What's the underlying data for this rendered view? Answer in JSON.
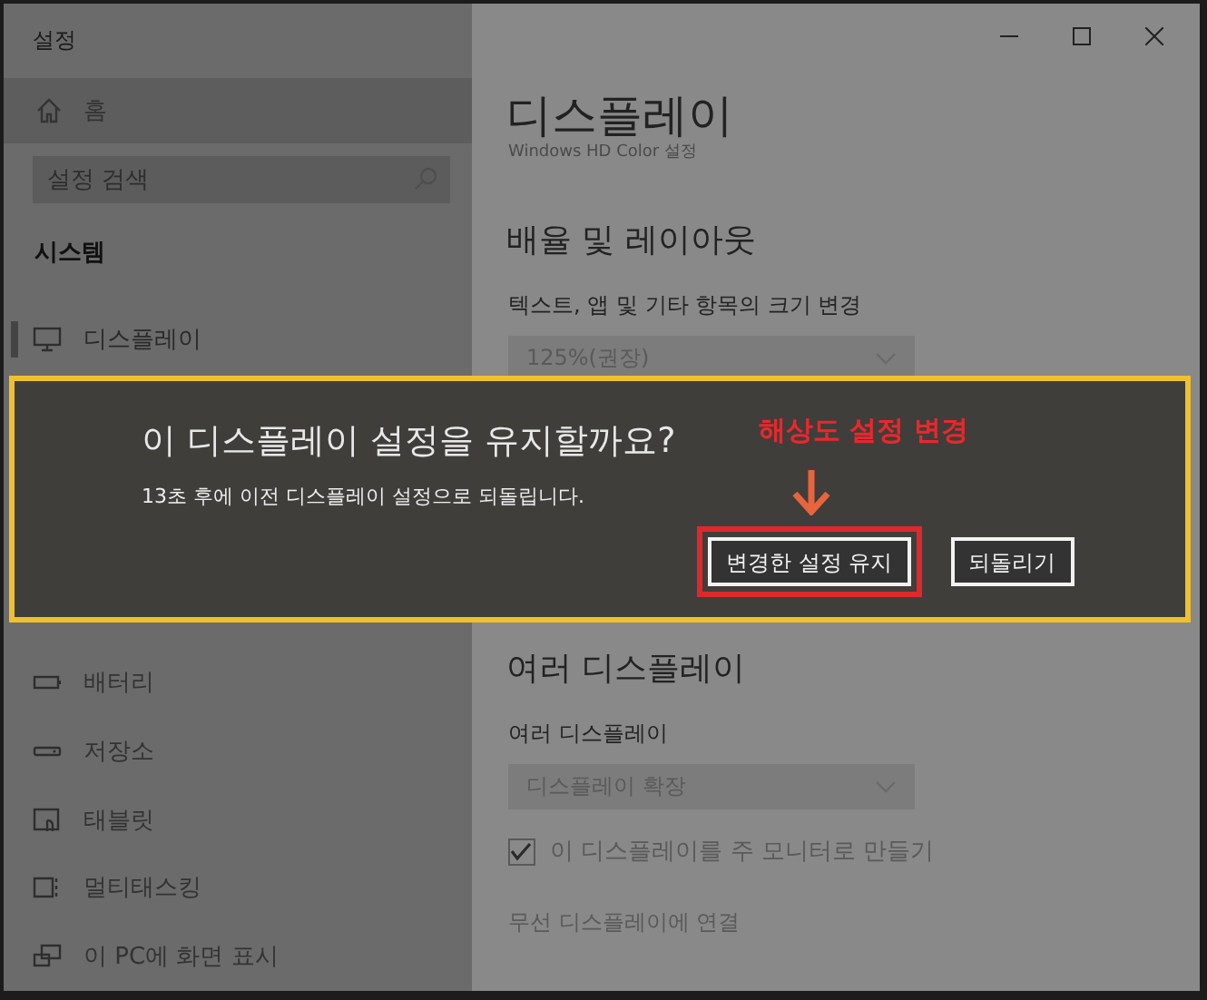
{
  "window": {
    "title": "설정"
  },
  "sidebar": {
    "home": "홈",
    "search": {
      "placeholder": "설정 검색"
    },
    "section": "시스템",
    "items": [
      {
        "label": "디스플레이",
        "kind": "display",
        "selected": true
      },
      {
        "label": "배터리",
        "kind": "battery",
        "selected": false
      },
      {
        "label": "저장소",
        "kind": "storage",
        "selected": false
      },
      {
        "label": "태블릿",
        "kind": "tablet",
        "selected": false
      },
      {
        "label": "멀티태스킹",
        "kind": "multitask",
        "selected": false
      },
      {
        "label": "이 PC에 화면 표시",
        "kind": "project",
        "selected": false
      }
    ]
  },
  "page": {
    "title": "디스플레이",
    "hd_color_link": "Windows HD Color 설정",
    "scale_heading": "배율 및 레이아웃",
    "scale_label": "텍스트, 앱 및 기타 항목의 크기 변경",
    "scale_value": "125%(권장)",
    "multi_heading": "여러 디스플레이",
    "multi_label": "여러 디스플레이",
    "multi_value": "디스플레이 확장",
    "main_monitor": {
      "label": "이 디스플레이를 주 모니터로 만들기",
      "checked": true
    },
    "wireless_link": "무선 디스플레이에 연결"
  },
  "dialog": {
    "title": "이 디스플레이 설정을 유지할까요?",
    "message": "13초 후에 이전 디스플레이 설정으로 되돌립니다.",
    "buttons": [
      {
        "label": "변경한 설정 유지",
        "highlighted": true
      },
      {
        "label": "되돌리기",
        "highlighted": false
      }
    ],
    "annotation": "해상도 설정 변경"
  }
}
